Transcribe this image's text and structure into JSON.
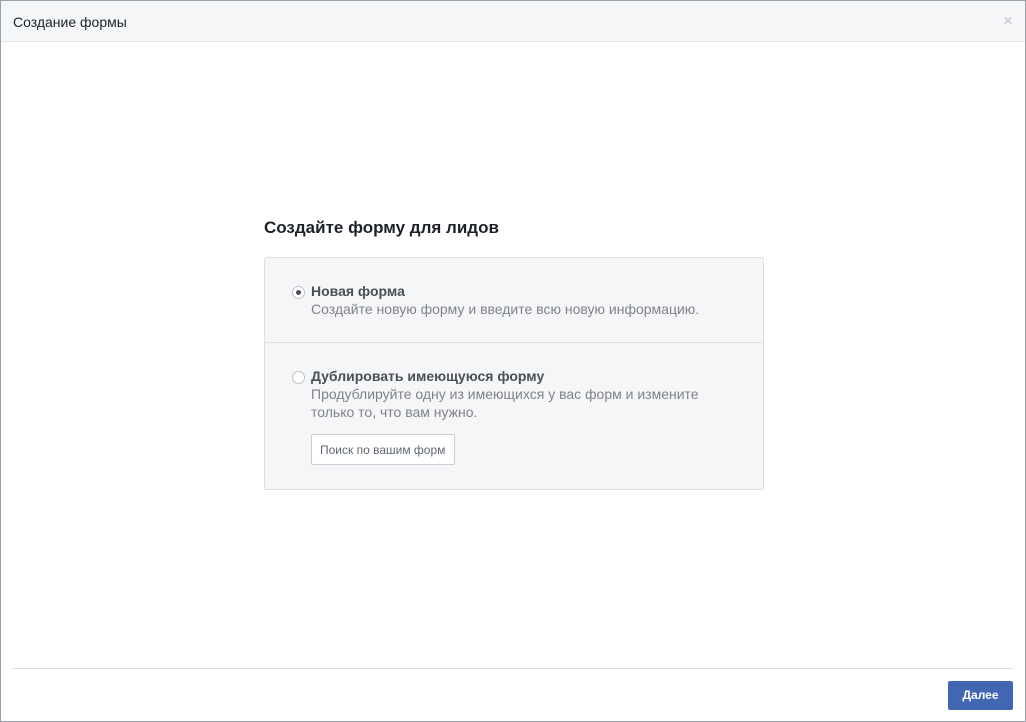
{
  "dialog": {
    "title": "Создание формы",
    "close_symbol": "×",
    "close_icon": "close-icon"
  },
  "main": {
    "heading": "Создайте форму для лидов",
    "options": [
      {
        "label": "Новая форма",
        "description": "Создайте новую форму и введите всю новую информацию.",
        "selected": true
      },
      {
        "label": "Дублировать имеющуюся форму",
        "description": "Продублируйте одну из имеющихся у вас форм и измените только то, что вам нужно.",
        "selected": false
      }
    ],
    "search": {
      "placeholder": "Поиск по вашим форм",
      "value": ""
    }
  },
  "footer": {
    "next_label": "Далее"
  },
  "colors": {
    "primary_button": "#4267b2",
    "header_background": "#f5f6f7",
    "options_background": "#f5f6f7",
    "border": "#dddfe2"
  }
}
